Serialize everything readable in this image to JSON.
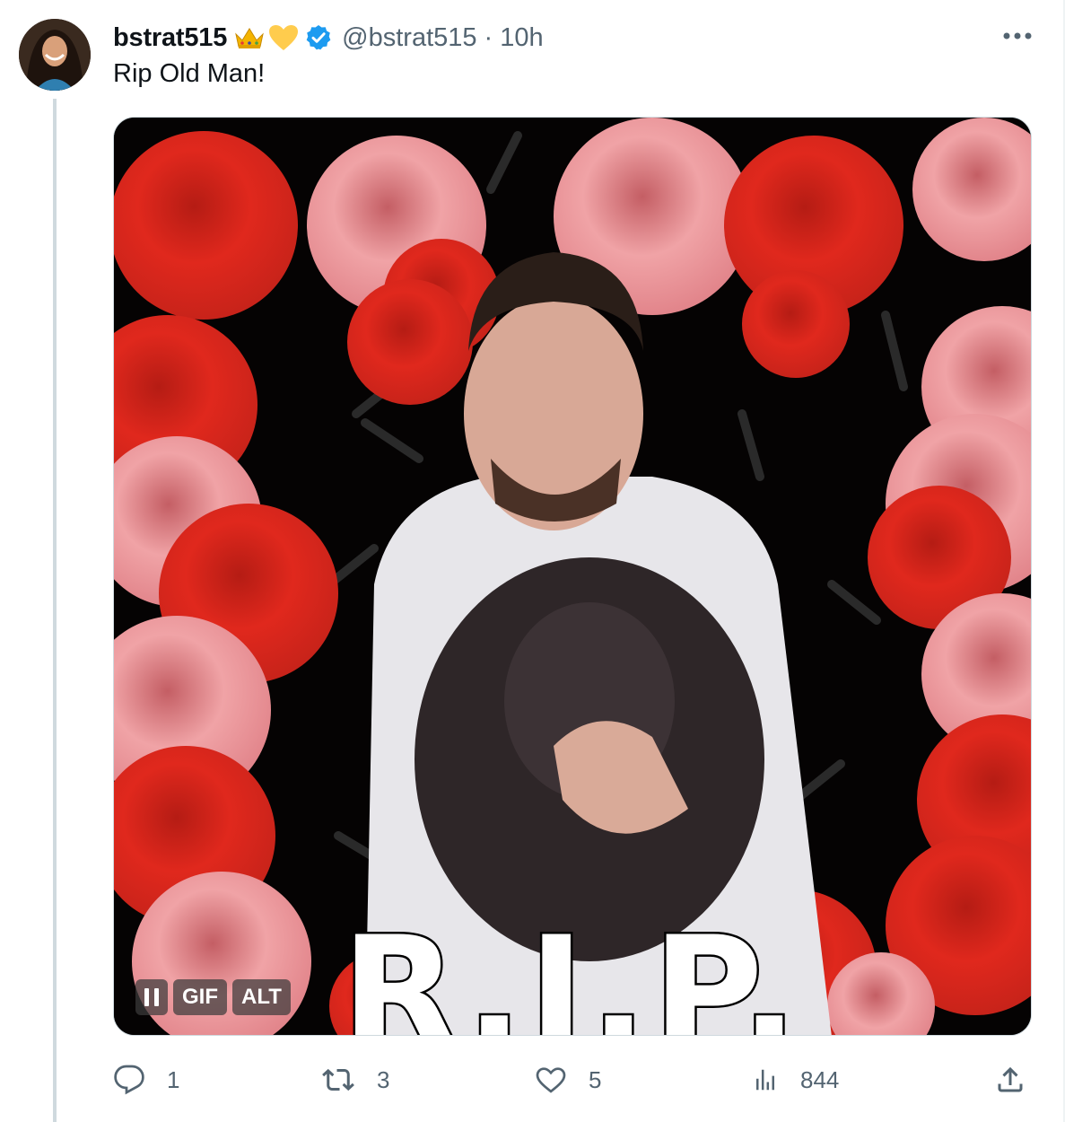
{
  "tweet": {
    "display_name": "bstrat515",
    "name_emojis": [
      "crown-emoji",
      "yellow-heart-emoji"
    ],
    "verified": true,
    "handle": "@bstrat515",
    "separator": "·",
    "time": "10h",
    "text": "Rip Old Man!"
  },
  "media": {
    "overlay_text": "R.I.P.",
    "badges": {
      "gif": "GIF",
      "alt": "ALT"
    },
    "pause_icon": "pause-icon"
  },
  "actions": {
    "replies": "1",
    "retweets": "3",
    "likes": "5",
    "views": "844"
  },
  "colors": {
    "text": "#0f1419",
    "secondary": "#536471",
    "verified": "#1d9bf0",
    "rose_red": "#d42a1f",
    "rose_pink": "#e2828a"
  }
}
